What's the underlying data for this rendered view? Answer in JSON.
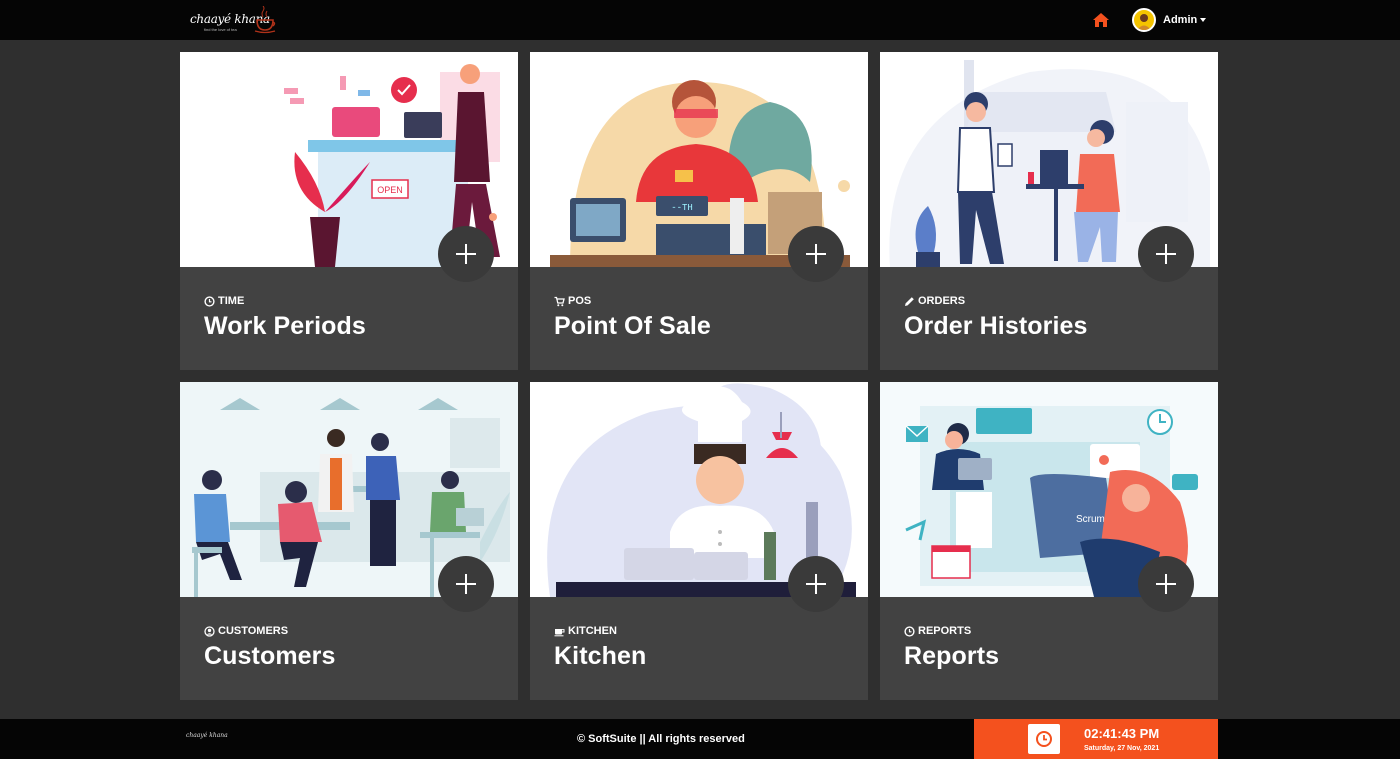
{
  "header": {
    "logo_text": "chaayé khana",
    "logo_tagline": "find the love of tea",
    "home_icon": "home-icon",
    "user_name": "Admin"
  },
  "cards": [
    {
      "category": "TIME",
      "category_icon": "clock-icon",
      "title": "Work Periods"
    },
    {
      "category": "POS",
      "category_icon": "cart-icon",
      "title": "Point Of Sale"
    },
    {
      "category": "ORDERS",
      "category_icon": "pencil-icon",
      "title": "Order Histories"
    },
    {
      "category": "CUSTOMERS",
      "category_icon": "user-circle-icon",
      "title": "Customers"
    },
    {
      "category": "KITCHEN",
      "category_icon": "cup-icon",
      "title": "Kitchen"
    },
    {
      "category": "REPORTS",
      "category_icon": "clock-icon",
      "title": "Reports"
    }
  ],
  "footer": {
    "logo_text": "chaayé khana",
    "copyright": "© SoftSuite || All rights reserved",
    "time": "02:41:43 PM",
    "date": "Saturday, 27 Nov, 2021"
  },
  "colors": {
    "accent": "#f4511e",
    "card_bg": "#424242",
    "page_bg": "#2f2f2f",
    "bar_bg": "#050505"
  }
}
